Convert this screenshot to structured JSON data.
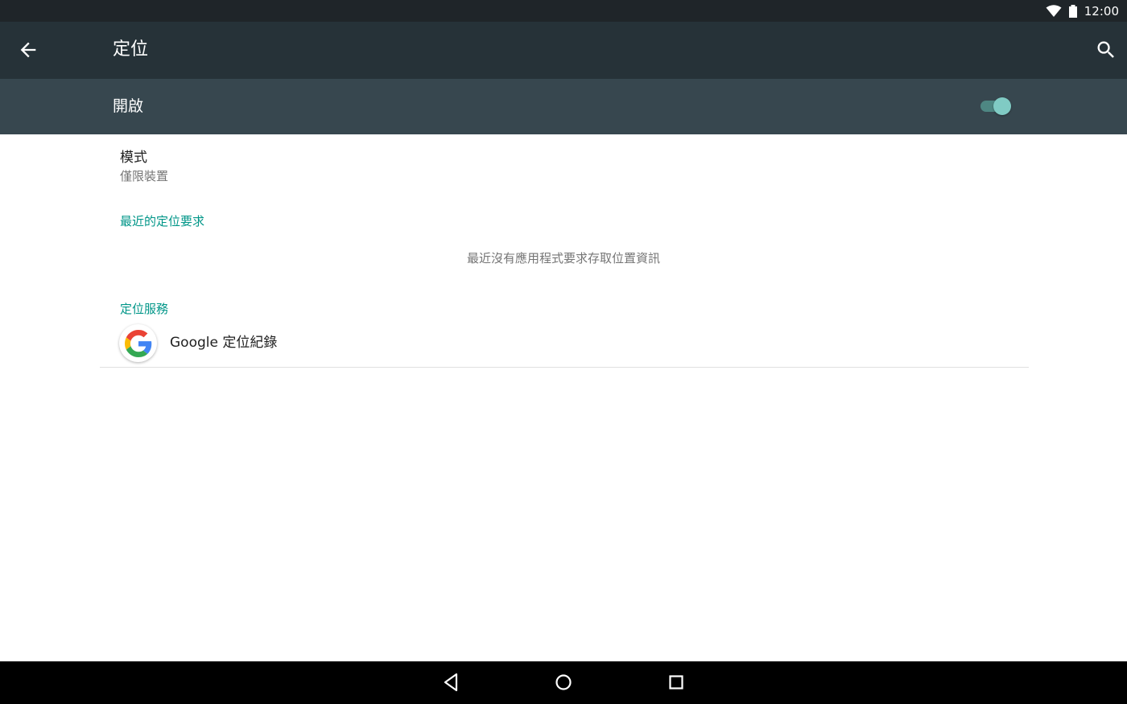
{
  "status_bar": {
    "time": "12:00",
    "icons": [
      "wifi-icon",
      "battery-icon"
    ]
  },
  "app_bar": {
    "title": "定位",
    "back_icon": "arrow-back-icon",
    "search_icon": "search-icon"
  },
  "master_switch": {
    "label": "開啟",
    "checked": true,
    "colors": {
      "thumb": "#80cbc4",
      "track": "#4e8783"
    }
  },
  "mode": {
    "title": "模式",
    "summary": "僅限裝置"
  },
  "recent_requests": {
    "header": "最近的定位要求",
    "empty_text": "最近沒有應用程式要求存取位置資訊"
  },
  "location_services": {
    "header": "定位服務",
    "items": [
      {
        "icon": "google-g-icon",
        "label": "Google 定位紀錄"
      }
    ]
  },
  "nav_bar": {
    "buttons": [
      "nav-back-icon",
      "nav-home-icon",
      "nav-recents-icon"
    ]
  },
  "colors": {
    "status_bar": "#1f2529",
    "app_bar": "#263238",
    "switch_bar": "#37474f",
    "accent": "#009688",
    "nav_bar": "#000000"
  }
}
